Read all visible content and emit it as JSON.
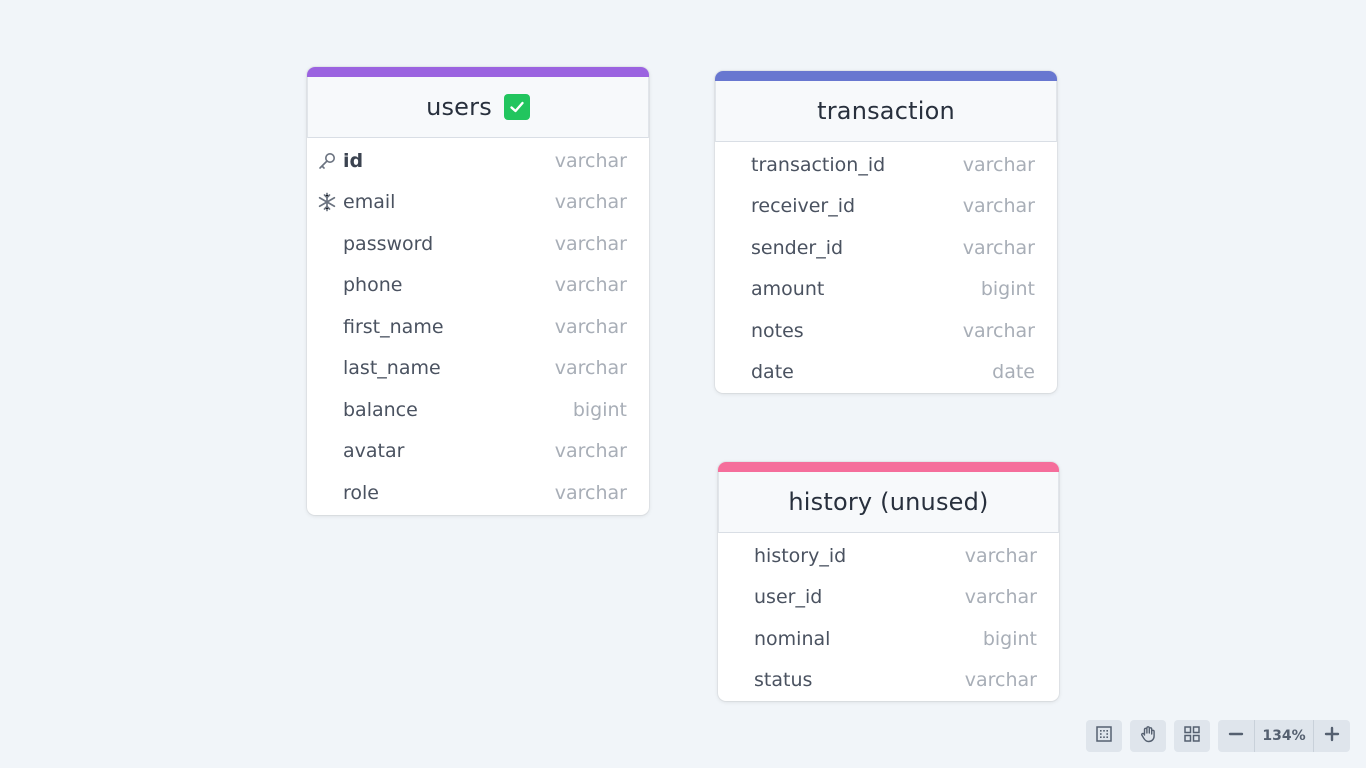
{
  "colors": {
    "canvas_bg": "#f1f5f9",
    "users_accent": "#9b63e0",
    "transaction_accent": "#6877d0",
    "history_accent": "#f56e9b",
    "check_green": "#22c55e"
  },
  "tables": {
    "users": {
      "title": "users",
      "status_icon": "checkbox-checked-icon",
      "fields": [
        {
          "name": "id",
          "type": "varchar",
          "icon": "key-icon"
        },
        {
          "name": "email",
          "type": "varchar",
          "icon": "snowflake-icon"
        },
        {
          "name": "password",
          "type": "varchar"
        },
        {
          "name": "phone",
          "type": "varchar"
        },
        {
          "name": "first_name",
          "type": "varchar"
        },
        {
          "name": "last_name",
          "type": "varchar"
        },
        {
          "name": "balance",
          "type": "bigint"
        },
        {
          "name": "avatar",
          "type": "varchar"
        },
        {
          "name": "role",
          "type": "varchar"
        }
      ]
    },
    "transaction": {
      "title": "transaction",
      "fields": [
        {
          "name": "transaction_id",
          "type": "varchar"
        },
        {
          "name": "receiver_id",
          "type": "varchar"
        },
        {
          "name": "sender_id",
          "type": "varchar"
        },
        {
          "name": "amount",
          "type": "bigint"
        },
        {
          "name": "notes",
          "type": "varchar"
        },
        {
          "name": "date",
          "type": "date"
        }
      ]
    },
    "history": {
      "title": "history (unused)",
      "fields": [
        {
          "name": "history_id",
          "type": "varchar"
        },
        {
          "name": "user_id",
          "type": "varchar"
        },
        {
          "name": "nominal",
          "type": "bigint"
        },
        {
          "name": "status",
          "type": "varchar"
        }
      ]
    }
  },
  "toolbar": {
    "fit_view_icon": "fit-view-icon",
    "pan_icon": "hand-icon",
    "grid_icon": "grid-layout-icon",
    "zoom_out_icon": "minus-icon",
    "zoom_in_icon": "plus-icon",
    "zoom_level": "134%"
  }
}
